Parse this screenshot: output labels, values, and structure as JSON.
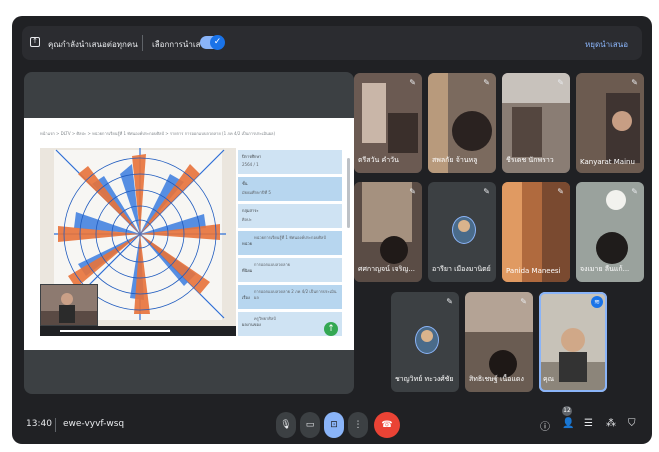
{
  "banner": {
    "text": "คุณกำลังนำเสนอต่อทุกคน",
    "option_label": "เลือกการนำเสนอ",
    "stop_label": "หยุดนำเสนอ"
  },
  "slide": {
    "breadcrumb": "หน้าแรก > DLTV > ศิลปะ > หน่วยการเรียนรู้ที่ 1 ทัศนองค์ประกอบศิลป์ > รายการ การออกแบบลวดลาย (1 ภค 4/2 เป็นการประเมินผล)",
    "rows": [
      {
        "key": "ปีการศึกษา",
        "value": "2564 / 1"
      },
      {
        "key": "ชั้น",
        "value": "มัธยมศึกษาปีที่ 5"
      },
      {
        "key": "กลุ่มสาระ",
        "value": "ศิลปะ"
      },
      {
        "key": "หน่วย",
        "value": "หน่วยการเรียนรู้ที่ 1 ทัศนองค์ประกอบศิลป์"
      },
      {
        "key": "ที่นิยม",
        "value": "การออกแบบลวดลาย"
      },
      {
        "key": "เรื่อง",
        "value": "การออกแบบลวดลาย 2 ภค 4/2 เป็นการประเมินผล"
      },
      {
        "key": "ผลงานของ",
        "value": "ครูวิทยาศิลป์"
      }
    ]
  },
  "tiles": [
    {
      "name": "ตรีสวัน คำวัน"
    },
    {
      "name": "สพลกัย จ้านหลู"
    },
    {
      "name": "ชีรเดช นักพราว"
    },
    {
      "name": "Kanyarat Mainu"
    },
    {
      "name": "ศศกาญจน์ เจริญ..."
    },
    {
      "name": "อารียา เมืองมานิตย์"
    },
    {
      "name": "Panida Maneesi"
    },
    {
      "name": "จงเมาย ลืนแก้..."
    },
    {
      "name": "ชาญวิทย์ ทะวงศ์ชัย"
    },
    {
      "name": "สิทธิเชษฐ์ เนื้อแดง"
    },
    {
      "name": "คุณ"
    }
  ],
  "bottom": {
    "time": "13:40",
    "meeting_code": "ewe-vyvf-wsq",
    "participants_count": "12"
  },
  "colors": {
    "accent": "#8ab4f8",
    "end_call": "#ea4335",
    "background": "#202124"
  }
}
